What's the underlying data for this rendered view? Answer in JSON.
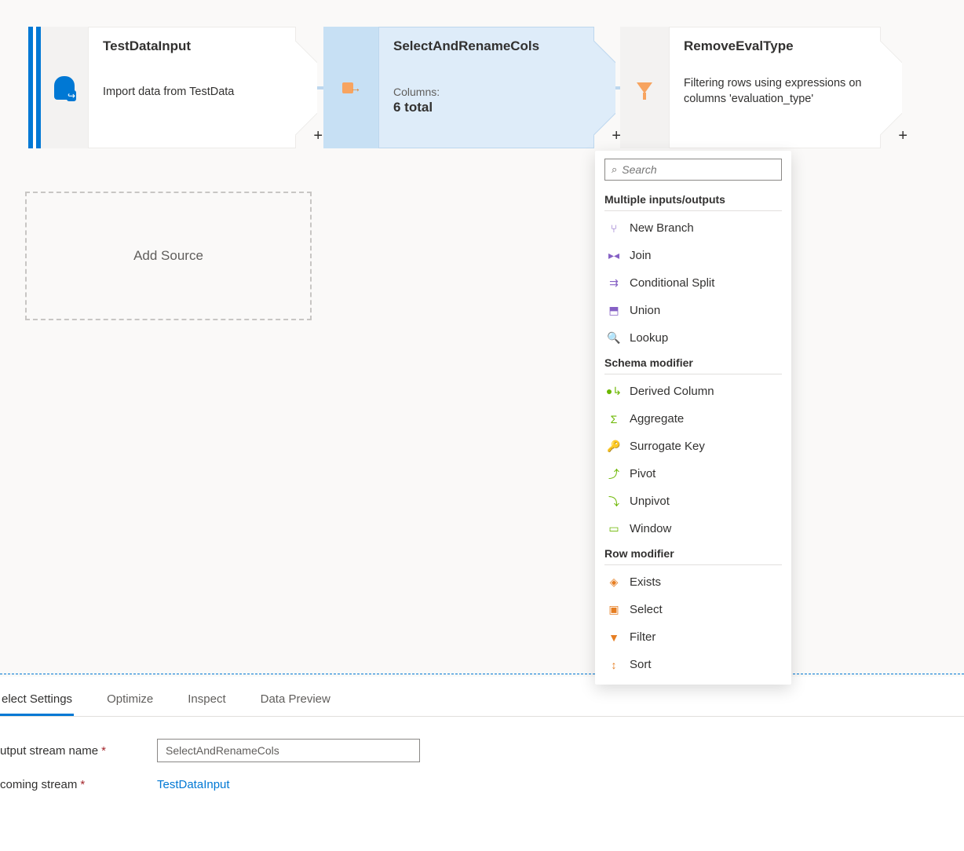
{
  "nodes": {
    "n1": {
      "title": "TestDataInput",
      "desc": "Import data from TestData"
    },
    "n2": {
      "title": "SelectAndRenameCols",
      "sub_label": "Columns:",
      "sub_val": "6 total"
    },
    "n3": {
      "title": "RemoveEvalType",
      "desc": "Filtering rows using expressions on columns 'evaluation_type'"
    }
  },
  "add_source": "Add Source",
  "menu": {
    "search_placeholder": "Search",
    "sections": {
      "mio": "Multiple inputs/outputs",
      "schema": "Schema modifier",
      "row": "Row modifier"
    },
    "items": {
      "new_branch": "New Branch",
      "join": "Join",
      "cond_split": "Conditional Split",
      "union": "Union",
      "lookup": "Lookup",
      "derived": "Derived Column",
      "aggregate": "Aggregate",
      "surrogate": "Surrogate Key",
      "pivot": "Pivot",
      "unpivot": "Unpivot",
      "window": "Window",
      "exists": "Exists",
      "select": "Select",
      "filter": "Filter",
      "sort": "Sort"
    }
  },
  "tabs": {
    "select_settings": "elect Settings",
    "optimize": "Optimize",
    "inspect": "Inspect",
    "data_preview": "Data Preview"
  },
  "form": {
    "output_label": "utput stream name",
    "output_value": "SelectAndRenameCols",
    "incoming_label": "coming stream",
    "incoming_value": "TestDataInput"
  }
}
